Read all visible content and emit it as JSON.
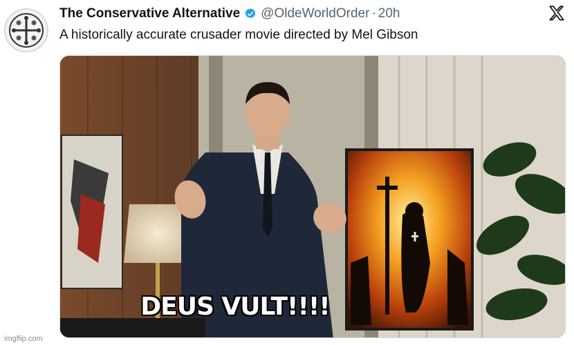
{
  "tweet": {
    "display_name": "The Conservative Alternative",
    "handle": "@OldeWorldOrder",
    "separator": "·",
    "time": "20h",
    "text": "A historically accurate crusader movie directed by Mel Gibson"
  },
  "icons": {
    "avatar": "cross-emblem-icon",
    "verified": "verified-badge-icon",
    "platform": "x-logo-icon"
  },
  "media": {
    "caption": "DEUS VULT!!!!",
    "watermark": "imgflip.com"
  },
  "colors": {
    "verified_blue": "#1d9bf0",
    "text_primary": "#0f1419",
    "text_secondary": "#536471"
  }
}
